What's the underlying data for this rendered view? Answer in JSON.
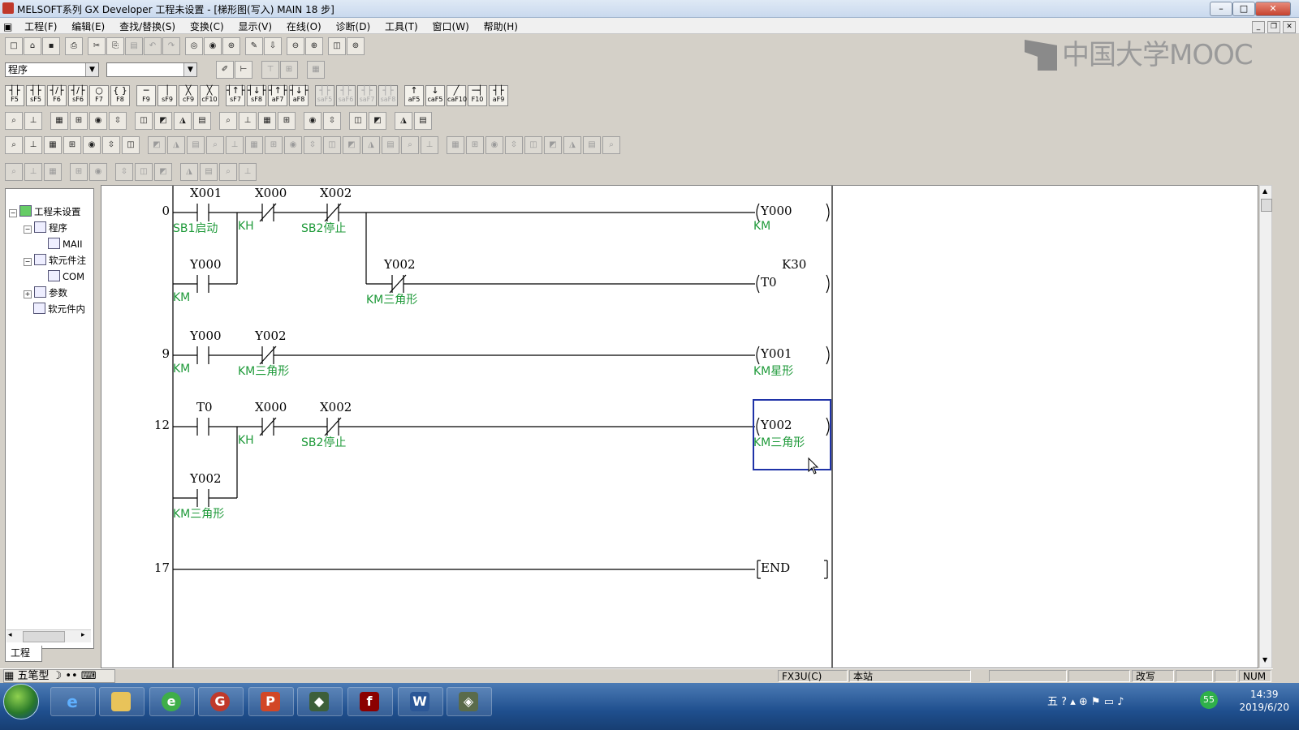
{
  "window": {
    "title": "MELSOFT系列 GX Developer 工程未设置 - [梯形图(写入)    MAIN    18 步]"
  },
  "menu": [
    "工程(F)",
    "编辑(E)",
    "查找/替换(S)",
    "变换(C)",
    "显示(V)",
    "在线(O)",
    "诊断(D)",
    "工具(T)",
    "窗口(W)",
    "帮助(H)"
  ],
  "toolbar": {
    "program_select": "程序",
    "fkeys": [
      "F5",
      "sF5",
      "F6",
      "sF6",
      "F7",
      "F8",
      "F9",
      "sF9",
      "cF9",
      "cF10",
      "sF7",
      "sF8",
      "aF7",
      "aF8",
      "saF5",
      "saF6",
      "saF7",
      "saF8",
      "aF5",
      "caF5",
      "caF10",
      "F10",
      "aF9"
    ]
  },
  "watermark": "中国大学MOOC",
  "tree": {
    "root": "工程未设置",
    "program": "程序",
    "main": "MAII",
    "device_comment": "软元件注",
    "com": "COM",
    "param": "参数",
    "device_memory": "软元件内",
    "tab": "工程",
    "close": "×"
  },
  "ladder": {
    "rungs": [
      {
        "step": "0"
      },
      {
        "step": "9"
      },
      {
        "step": "12"
      },
      {
        "step": "17"
      }
    ],
    "labels": {
      "r0_x001": "X001",
      "r0_x000": "X000",
      "r0_x002": "X002",
      "r0_out": "Y000",
      "r0_c1": "SB1启动",
      "r0_c2": "KH",
      "r0_c3": "SB2停止",
      "r0_oc": "KM",
      "r0_y000": "Y000",
      "r0_y000c": "KM",
      "r0_y002": "Y002",
      "r0_y002c": "KM三角形",
      "r0_t0": "T0",
      "r0_k30": "K30",
      "r9_y000": "Y000",
      "r9_y002": "Y002",
      "r9_c1": "KM",
      "r9_c2": "KM三角形",
      "r9_out": "Y001",
      "r9_oc": "KM星形",
      "r12_t0": "T0",
      "r12_x000": "X000",
      "r12_x002": "X002",
      "r12_c2": "KH",
      "r12_c3": "SB2停止",
      "r12_out": "Y002",
      "r12_oc": "KM三角形",
      "r12_y002": "Y002",
      "r12_y002c": "KM三角形",
      "r17_end": "END"
    }
  },
  "status": {
    "plc": "FX3U(C)",
    "station": "本站",
    "mode": "改写",
    "num": "NUM"
  },
  "taskbar": {
    "ime": "五笔型",
    "time": "14:39",
    "date": "2019/6/20",
    "badge": "55"
  }
}
